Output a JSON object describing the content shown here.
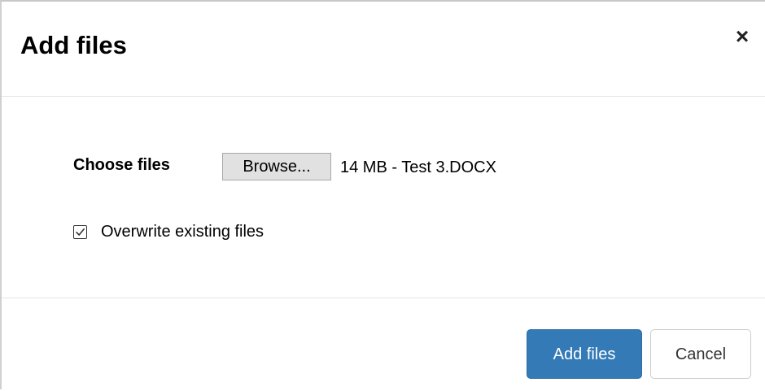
{
  "dialog": {
    "title": "Add files",
    "close_glyph": "×",
    "close_icon": "close-icon"
  },
  "form": {
    "choose_label": "Choose files",
    "browse_label": "Browse...",
    "selected_file": "14 MB - Test 3.DOCX",
    "overwrite_label": "Overwrite existing files",
    "overwrite_checked": true
  },
  "footer": {
    "add_label": "Add files",
    "cancel_label": "Cancel"
  },
  "colors": {
    "primary": "#337ab7",
    "primary_border": "#2e6da4",
    "divider": "#e5e5e5"
  }
}
